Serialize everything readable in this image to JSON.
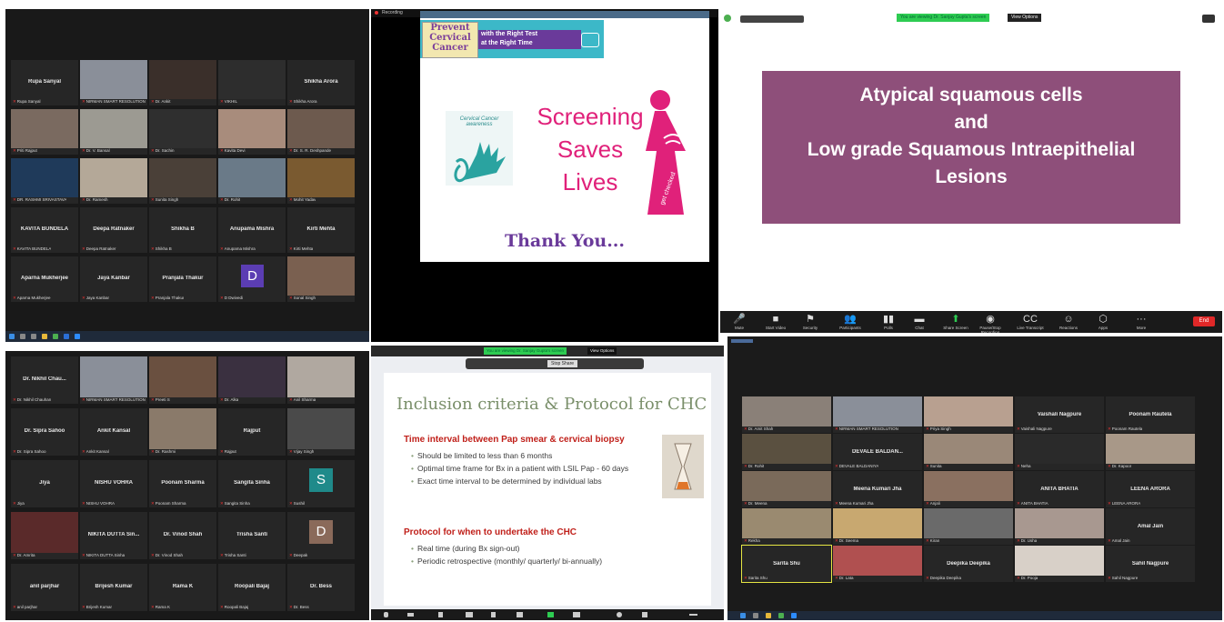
{
  "panel1": {
    "tiles": [
      {
        "name": "Rupa Sanyal",
        "cap": "Rupa Sanyal",
        "bg": "#262626"
      },
      {
        "name": "",
        "cap": "NIRMAN SMART RESOLUTION",
        "bg": "#8a8f99"
      },
      {
        "name": "",
        "cap": "Dr. Ankit",
        "bg": "#3a2f2a"
      },
      {
        "name": "",
        "cap": "VIKHIL",
        "bg": "#2d2d2d"
      },
      {
        "name": "Shikha Arora",
        "cap": "Shikha Arora",
        "bg": "#262626"
      },
      {
        "name": "",
        "cap": "Priti Rajput",
        "bg": "#7a6a60"
      },
      {
        "name": "",
        "cap": "Dr. V. Bansal",
        "bg": "#9c9a92"
      },
      {
        "name": "",
        "cap": "Dr. Sachin",
        "bg": "#2f2f2f"
      },
      {
        "name": "",
        "cap": "Kavita Devi",
        "bg": "#a88c7c"
      },
      {
        "name": "",
        "cap": "Dr. S. R. Deshpande",
        "bg": "#6d5a4e"
      },
      {
        "name": "",
        "cap": "DR. RASHMI SRIVASTAVA",
        "bg": "#1f3a5a"
      },
      {
        "name": "",
        "cap": "Dr. Ramesh",
        "bg": "#b4a898"
      },
      {
        "name": "",
        "cap": "Sunita Singh",
        "bg": "#4a4038"
      },
      {
        "name": "",
        "cap": "Dr. Rohit",
        "bg": "#6a7a88"
      },
      {
        "name": "",
        "cap": "Mohit Yadav",
        "bg": "#7a5a30"
      },
      {
        "name": "KAVITA BUNDELA",
        "cap": "KAVITA BUNDELA",
        "bg": "#262626"
      },
      {
        "name": "Deepa Ratnaker",
        "cap": "Deepa Ratnaker",
        "bg": "#262626"
      },
      {
        "name": "Shikha B",
        "cap": "Shikha B",
        "bg": "#262626"
      },
      {
        "name": "Anupama Mishra",
        "cap": "Anupama Mishra",
        "bg": "#262626"
      },
      {
        "name": "Kirti Mehta",
        "cap": "Kirti Mehta",
        "bg": "#262626"
      },
      {
        "name": "Aparna Mukherjee",
        "cap": "Aparna Mukherjee",
        "bg": "#262626"
      },
      {
        "name": "Jaya Kanbar",
        "cap": "Jaya Kanbar",
        "bg": "#262626"
      },
      {
        "name": "Pranjala Thakur",
        "cap": "Pranjala Thakur",
        "bg": "#262626"
      },
      {
        "name": "",
        "cap": "D Dwivedi",
        "bg": "#262626",
        "avatar": "D",
        "avatarColor": "#5b3db3"
      },
      {
        "name": "",
        "cap": "Sonal Singh",
        "bg": "#7a6050"
      }
    ]
  },
  "panel2": {
    "header": "Recording",
    "banner_line1": "Prevent",
    "banner_line2": "Cervical",
    "banner_line3": "Cancer",
    "banner_right1": "with the Right Test",
    "banner_right2": "at the Right Time",
    "awareness": "Cervical Cancer awareness",
    "screening1": "Screening",
    "screening2": "Saves",
    "screening3": "Lives",
    "getchecked": "get checked",
    "thankyou": "Thank You..."
  },
  "panel3": {
    "viewing_banner": "You are viewing Dr. Sanjay Gupta's screen",
    "view_options": "View Options",
    "slide_line1": "Atypical squamous cells",
    "slide_line2": "and",
    "slide_line3": "Low grade Squamous Intraepithelial",
    "slide_line4": "Lesions",
    "toolbar": [
      {
        "icon": "🎤",
        "label": "Mute"
      },
      {
        "icon": "■",
        "label": "Start Video"
      },
      {
        "icon": "⚑",
        "label": "Security"
      },
      {
        "icon": "👥",
        "label": "Participants"
      },
      {
        "icon": "▮▮",
        "label": "Polls"
      },
      {
        "icon": "▬",
        "label": "Chat"
      },
      {
        "icon": "⬆",
        "label": "Share Screen"
      },
      {
        "icon": "◉",
        "label": "Pause/Stop Recording"
      },
      {
        "icon": "CC",
        "label": "Live Transcript"
      },
      {
        "icon": "☺",
        "label": "Reactions"
      },
      {
        "icon": "⬡",
        "label": "Apps"
      },
      {
        "icon": "···",
        "label": "More"
      }
    ],
    "end": "End"
  },
  "panel4": {
    "tiles": [
      {
        "name": "Dr. Nikhil Chau...",
        "cap": "Dr. Nikhil Chauhan",
        "bg": "#262626"
      },
      {
        "name": "",
        "cap": "NIRMAN SMART RESOLUTION",
        "bg": "#8a8f99"
      },
      {
        "name": "",
        "cap": "Preeti S",
        "bg": "#6a5040"
      },
      {
        "name": "",
        "cap": "Dr. Alka",
        "bg": "#3a3040"
      },
      {
        "name": "",
        "cap": "Anil Sharma",
        "bg": "#b0a8a0"
      },
      {
        "name": "Dr. Sipra Sahoo",
        "cap": "Dr. Sipra Sahoo",
        "bg": "#262626"
      },
      {
        "name": "Ankit Kansal",
        "cap": "Ankit Kansal",
        "bg": "#262626"
      },
      {
        "name": "",
        "cap": "Dr. Rashmi",
        "bg": "#8a7a6a"
      },
      {
        "name": "Rajput",
        "cap": "Rajput",
        "bg": "#262626"
      },
      {
        "name": "",
        "cap": "Vijay Singh",
        "bg": "#4a4a4a"
      },
      {
        "name": "Jiya",
        "cap": "Jiya",
        "bg": "#262626"
      },
      {
        "name": "NISHU VOHRA",
        "cap": "NISHU VOHRA",
        "bg": "#262626"
      },
      {
        "name": "Poonam Sharma",
        "cap": "Poonam Sharma",
        "bg": "#262626"
      },
      {
        "name": "Sangita Sinha",
        "cap": "Sangita Sinha",
        "bg": "#262626"
      },
      {
        "name": "",
        "cap": "Sushil",
        "bg": "#262626",
        "avatar": "S",
        "avatarColor": "#1f8a8a"
      },
      {
        "name": "",
        "cap": "Dr. Amrita",
        "bg": "#5a2a2a"
      },
      {
        "name": "NIKITA DUTTA Sin...",
        "cap": "NIKITA DUTTA Sinha",
        "bg": "#262626"
      },
      {
        "name": "Dr. Vinod Shah",
        "cap": "Dr. Vinod Shah",
        "bg": "#262626"
      },
      {
        "name": "Trisha Santi",
        "cap": "Trisha Santi",
        "bg": "#262626"
      },
      {
        "name": "",
        "cap": "Deepak",
        "bg": "#262626",
        "avatar": "D",
        "avatarColor": "#8a6a5a"
      },
      {
        "name": "anil parjhar",
        "cap": "anil parjhar",
        "bg": "#262626"
      },
      {
        "name": "Brijesh Kumar",
        "cap": "Brijesh Kumar",
        "bg": "#262626"
      },
      {
        "name": "Rama K",
        "cap": "Rama K",
        "bg": "#262626"
      },
      {
        "name": "Roopali Bajaj",
        "cap": "Roopali Bajaj",
        "bg": "#262626"
      },
      {
        "name": "Dr. Bess",
        "cap": "Dr. Bess",
        "bg": "#262626"
      }
    ]
  },
  "panel5": {
    "viewing_banner": "You are viewing Dr. Sanjay Gupta's screen",
    "view_options": "View Options",
    "share_bar": "Stop Share",
    "title": "Inclusion criteria & Protocol for CHC",
    "heading1": "Time interval between Pap smear & cervical biopsy",
    "bullets1": [
      "Should be limited to less than 6 months",
      "Optimal time frame for Bx in a patient with LSIL Pap - 60 days",
      "Exact time interval to be determined by individual labs"
    ],
    "heading2": "Protocol for when  to undertake the CHC",
    "bullets2": [
      "Real time (during Bx sign-out)",
      "Periodic retrospective (monthly/ quarterly/ bi-annually)"
    ]
  },
  "panel6": {
    "tiles": [
      {
        "name": "",
        "cap": "Dr. Amit Shah",
        "bg": "#8a8078"
      },
      {
        "name": "",
        "cap": "NIRMAN SMART RESOLUTION",
        "bg": "#8a8f99"
      },
      {
        "name": "",
        "cap": "Priya Singh",
        "bg": "#b8a090"
      },
      {
        "name": "Vaishali Nagpure",
        "cap": "Vaishali Nagpure",
        "bg": "#262626"
      },
      {
        "name": "Poonam Rautela",
        "cap": "Poonam Rautela",
        "bg": "#262626"
      },
      {
        "name": "",
        "cap": "Dr. Rohit",
        "bg": "#5a5040"
      },
      {
        "name": "DEVALE BALDAN...",
        "cap": "DEVALE BALDANIYA",
        "bg": "#262626"
      },
      {
        "name": "",
        "cap": "Sunita",
        "bg": "#9a8878"
      },
      {
        "name": "",
        "cap": "Neha",
        "bg": "#2a2a2a"
      },
      {
        "name": "",
        "cap": "Dr. Kapoor",
        "bg": "#a89888"
      },
      {
        "name": "",
        "cap": "Dr. Meena",
        "bg": "#7a6a5a"
      },
      {
        "name": "Meena Kumari Jha",
        "cap": "Meena Kumari Jha",
        "bg": "#262626"
      },
      {
        "name": "",
        "cap": "Anjali",
        "bg": "#8a7060"
      },
      {
        "name": "ANITA BHATIA",
        "cap": "ANITA BHATIA",
        "bg": "#262626"
      },
      {
        "name": "LEENA ARORA",
        "cap": "LEENA ARORA",
        "bg": "#262626"
      },
      {
        "name": "",
        "cap": "Rekha",
        "bg": "#9a8a70"
      },
      {
        "name": "",
        "cap": "Dr. Seema",
        "bg": "#c8a870"
      },
      {
        "name": "",
        "cap": "Kiran",
        "bg": "#6a6a6a"
      },
      {
        "name": "",
        "cap": "Dr. Usha",
        "bg": "#a89890"
      },
      {
        "name": "Amal Jain",
        "cap": "Amal Jain",
        "bg": "#262626"
      },
      {
        "name": "Sarita Shu",
        "cap": "Sarita Shu",
        "bg": "#262626",
        "active": true
      },
      {
        "name": "",
        "cap": "Dr. Lata",
        "bg": "#b05050"
      },
      {
        "name": "Deepika Deepika",
        "cap": "Deepika Deepika",
        "bg": "#262626"
      },
      {
        "name": "",
        "cap": "Dr. Pooja",
        "bg": "#d8d0c8"
      },
      {
        "name": "Sahil Nagpure",
        "cap": "Sahil Nagpure",
        "bg": "#262626"
      }
    ]
  }
}
